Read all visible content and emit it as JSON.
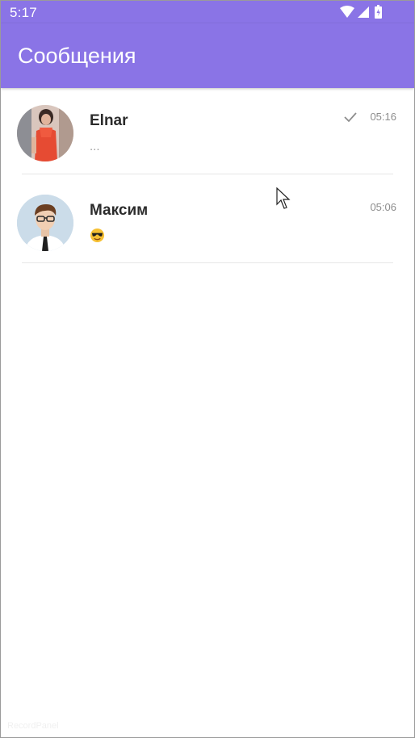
{
  "status_bar": {
    "time": "5:17"
  },
  "app_bar": {
    "title": "Сообщения"
  },
  "conversations": [
    {
      "name": "Elnar",
      "preview": "...",
      "time": "05:16",
      "read_receipt": "check-icon"
    },
    {
      "name": "Максим",
      "preview_emoji": "sunglasses-emoji",
      "time": "05:06"
    }
  ],
  "colors": {
    "accent": "#8a74e6",
    "background": "#ffffff",
    "divider": "#e6e6e6"
  }
}
